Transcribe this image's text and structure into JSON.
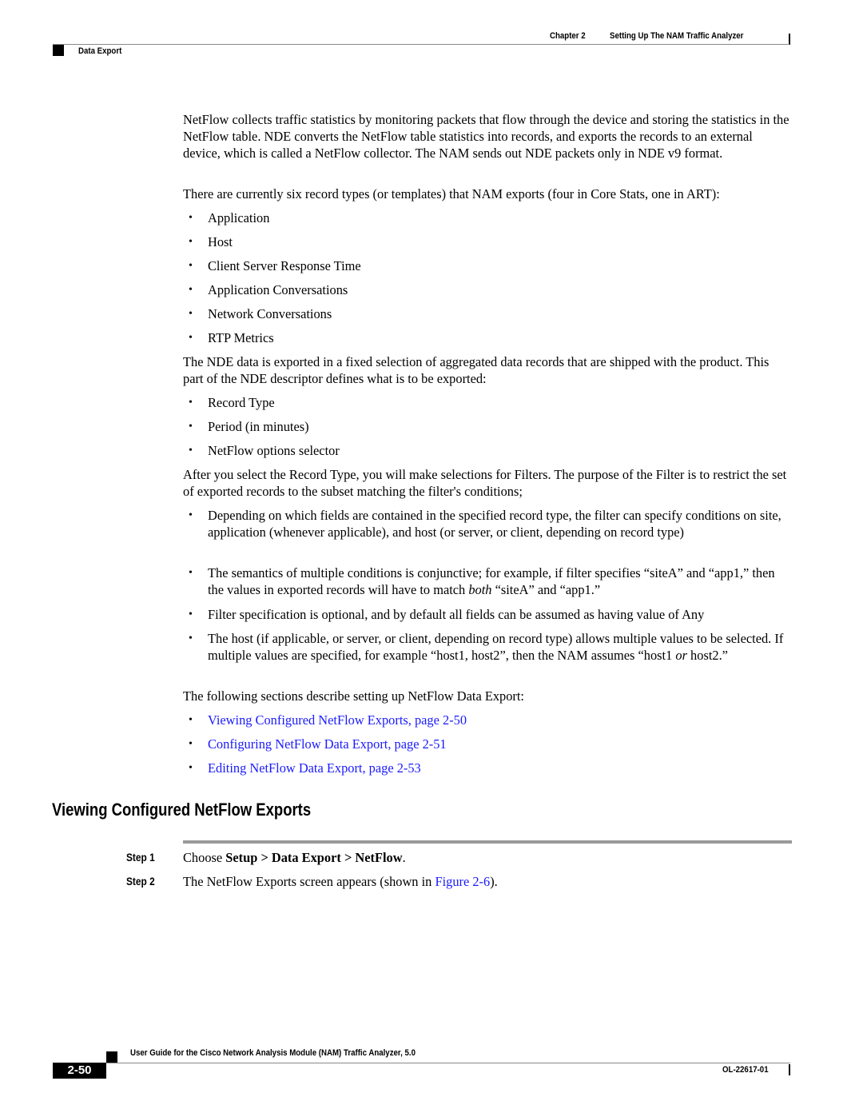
{
  "header": {
    "chapter": "Chapter 2",
    "chapter_title": "Setting Up The NAM Traffic Analyzer",
    "section": "Data Export"
  },
  "body": {
    "intro": "NetFlow collects traffic statistics by monitoring packets that flow through the device and storing the statistics in the NetFlow table. NDE converts the NetFlow table statistics into records, and exports the records to an external device, which is called a NetFlow collector. The NAM sends out NDE packets only in NDE v9 format.",
    "record_types_intro": "There are currently six record types (or templates) that NAM exports (four in Core Stats, one in ART):",
    "record_types": [
      "Application",
      "Host",
      "Client Server Response Time",
      "Application Conversations",
      "Network Conversations",
      "RTP Metrics"
    ],
    "nde_intro": "The NDE data is exported in a fixed selection of aggregated data records that are shipped with the product. This part of the NDE descriptor defines what is to be exported:",
    "nde_items": [
      "Record Type",
      "Period (in minutes)",
      "NetFlow options selector"
    ],
    "filter_intro": "After you select the Record Type, you will make selections for Filters. The purpose of the Filter is to restrict the set of exported records to the subset matching the filter's conditions;",
    "filter_items": [
      {
        "text": "Depending on which fields are contained in the specified record type, the filter can specify conditions on site, application (whenever applicable), and host (or server, or client, depending on record type)"
      },
      {
        "pre": "The semantics of multiple conditions is conjunctive; for example, if filter specifies “siteA” and “app1,” then the values in exported records will have to match ",
        "em": "both",
        "post": " “siteA” and “app1.”"
      },
      {
        "text": "Filter specification is optional, and by default all fields can be assumed as having value of Any"
      },
      {
        "pre": "The host (if applicable, or server, or client, depending on record type) allows multiple values to be selected. If multiple values are specified, for example “host1, host2”, then the NAM assumes “host1 ",
        "em": "or",
        "post": " host2.”"
      }
    ],
    "sections_intro": "The following sections describe setting up NetFlow Data Export:",
    "section_links": [
      "Viewing Configured NetFlow Exports, page 2-50",
      "Configuring NetFlow Data Export, page 2-51",
      "Editing NetFlow Data Export, page 2-53"
    ]
  },
  "section": {
    "heading": "Viewing Configured NetFlow Exports",
    "steps": [
      {
        "label": "Step 1",
        "pre": "Choose ",
        "bold": "Setup > Data Export > NetFlow",
        "post": "."
      },
      {
        "label": "Step 2",
        "pre": "The NetFlow Exports screen appears (shown in ",
        "link": "Figure 2-6",
        "post": ")."
      }
    ]
  },
  "footer": {
    "guide_title": "User Guide for the Cisco Network Analysis Module (NAM) Traffic Analyzer, 5.0",
    "page_number": "2-50",
    "doc_id": "OL-22617-01"
  },
  "colors": {
    "link": "#1a1aff",
    "rule": "#8a8a8a"
  }
}
